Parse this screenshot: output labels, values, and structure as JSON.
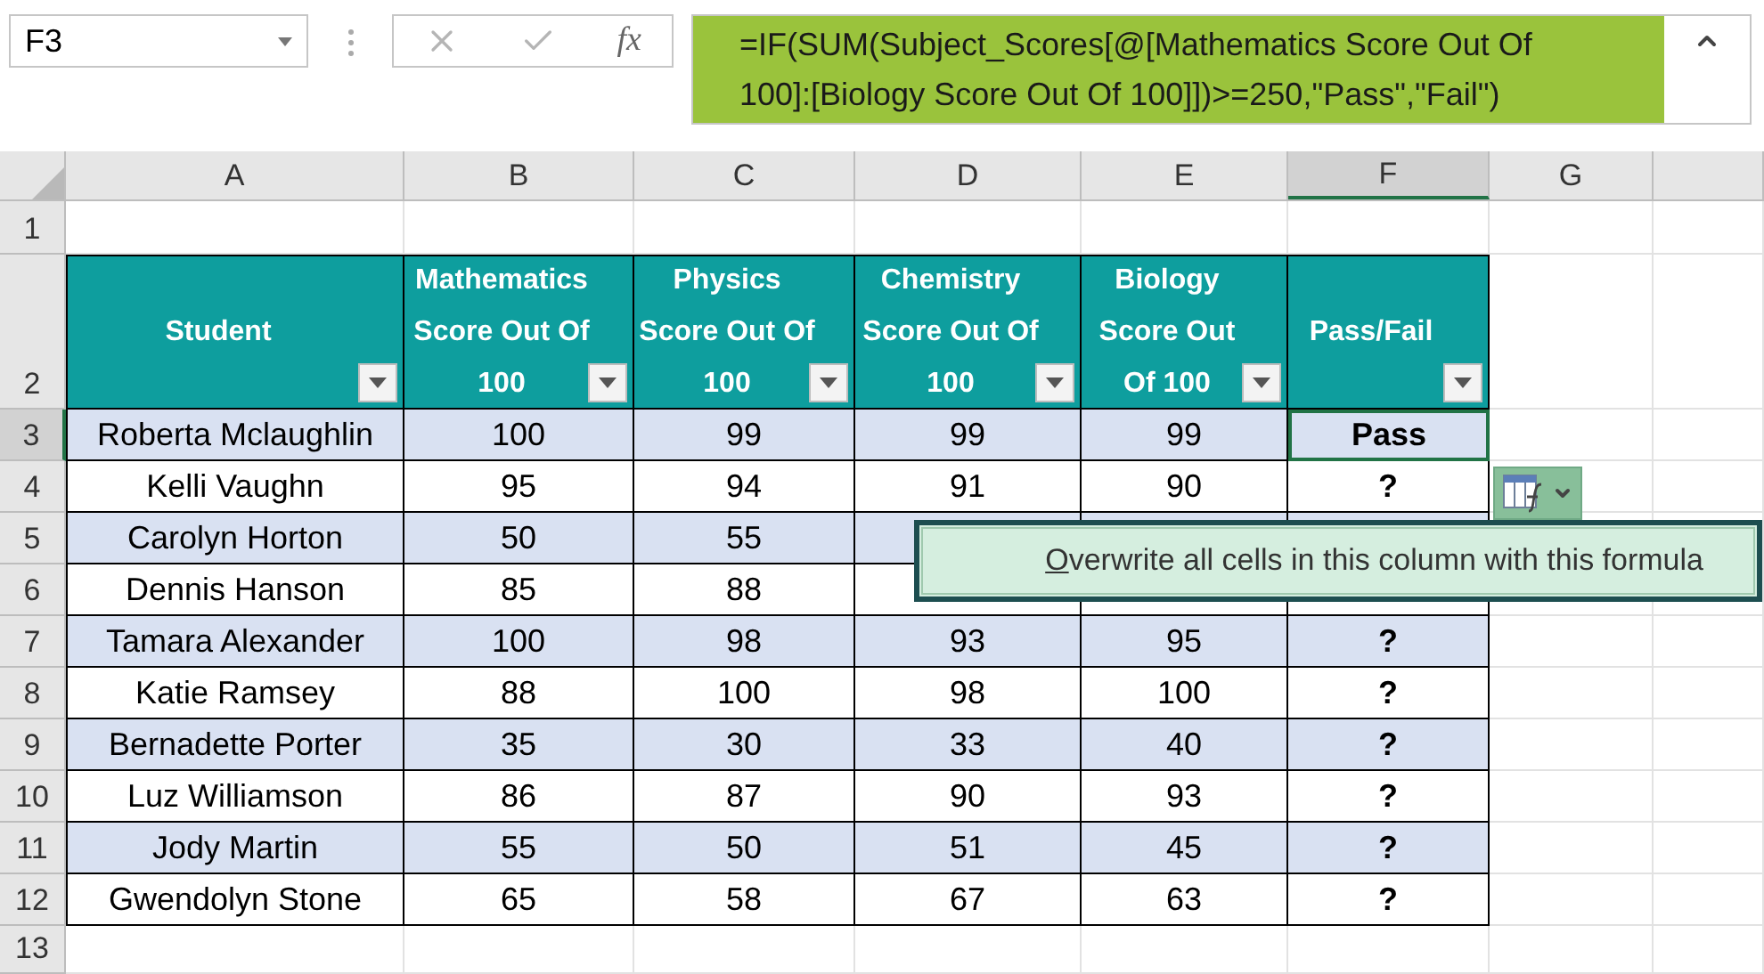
{
  "name_box": {
    "value": "F3"
  },
  "formula_bar": {
    "insert_function": "fx",
    "formula": "=IF(SUM(Subject_Scores[@[Mathematics Score Out Of 100]:[Biology Score Out Of 100]])>=250,\"Pass\",\"Fail\")"
  },
  "column_headers": [
    {
      "label": "A",
      "selected": false
    },
    {
      "label": "B",
      "selected": false
    },
    {
      "label": "C",
      "selected": false
    },
    {
      "label": "D",
      "selected": false
    },
    {
      "label": "E",
      "selected": false
    },
    {
      "label": "F",
      "selected": true
    },
    {
      "label": "G",
      "selected": false
    }
  ],
  "row_headers": [
    {
      "label": "1",
      "selected": false
    },
    {
      "label": "2",
      "selected": false
    },
    {
      "label": "3",
      "selected": true
    },
    {
      "label": "4",
      "selected": false
    },
    {
      "label": "5",
      "selected": false
    },
    {
      "label": "6",
      "selected": false
    },
    {
      "label": "7",
      "selected": false
    },
    {
      "label": "8",
      "selected": false
    },
    {
      "label": "9",
      "selected": false
    },
    {
      "label": "10",
      "selected": false
    },
    {
      "label": "11",
      "selected": false
    },
    {
      "label": "12",
      "selected": false
    },
    {
      "label": "13",
      "selected": false
    }
  ],
  "table": {
    "columns": [
      "Student",
      "Mathematics Score Out Of 100",
      "Physics Score Out Of 100",
      "Chemistry Score Out Of 100",
      "Biology Score Out Of 100",
      "Pass/Fail"
    ],
    "rows": [
      {
        "cells": [
          "Roberta Mclaughlin",
          "100",
          "99",
          "99",
          "99",
          "Pass"
        ],
        "result_selected": true
      },
      {
        "cells": [
          "Kelli Vaughn",
          "95",
          "94",
          "91",
          "90",
          "?"
        ],
        "result_selected": false
      },
      {
        "cells": [
          "Carolyn Horton",
          "50",
          "55",
          null,
          null,
          null
        ]
      },
      {
        "cells": [
          "Dennis Hanson",
          "85",
          "88",
          null,
          null,
          null
        ]
      },
      {
        "cells": [
          "Tamara Alexander",
          "100",
          "98",
          "93",
          "95",
          "?"
        ],
        "result_selected": false
      },
      {
        "cells": [
          "Katie Ramsey",
          "88",
          "100",
          "98",
          "100",
          "?"
        ],
        "result_selected": false
      },
      {
        "cells": [
          "Bernadette Porter",
          "35",
          "30",
          "33",
          "40",
          "?"
        ],
        "result_selected": false
      },
      {
        "cells": [
          "Luz Williamson",
          "86",
          "87",
          "90",
          "93",
          "?"
        ],
        "result_selected": false
      },
      {
        "cells": [
          "Jody Martin",
          "55",
          "50",
          "51",
          "45",
          "?"
        ],
        "result_selected": false
      },
      {
        "cells": [
          "Gwendolyn Stone",
          "65",
          "58",
          "67",
          "63",
          "?"
        ],
        "result_selected": false
      }
    ]
  },
  "autocorrect_tooltip": {
    "text": "Overwrite all cells in this column with this formula"
  }
}
